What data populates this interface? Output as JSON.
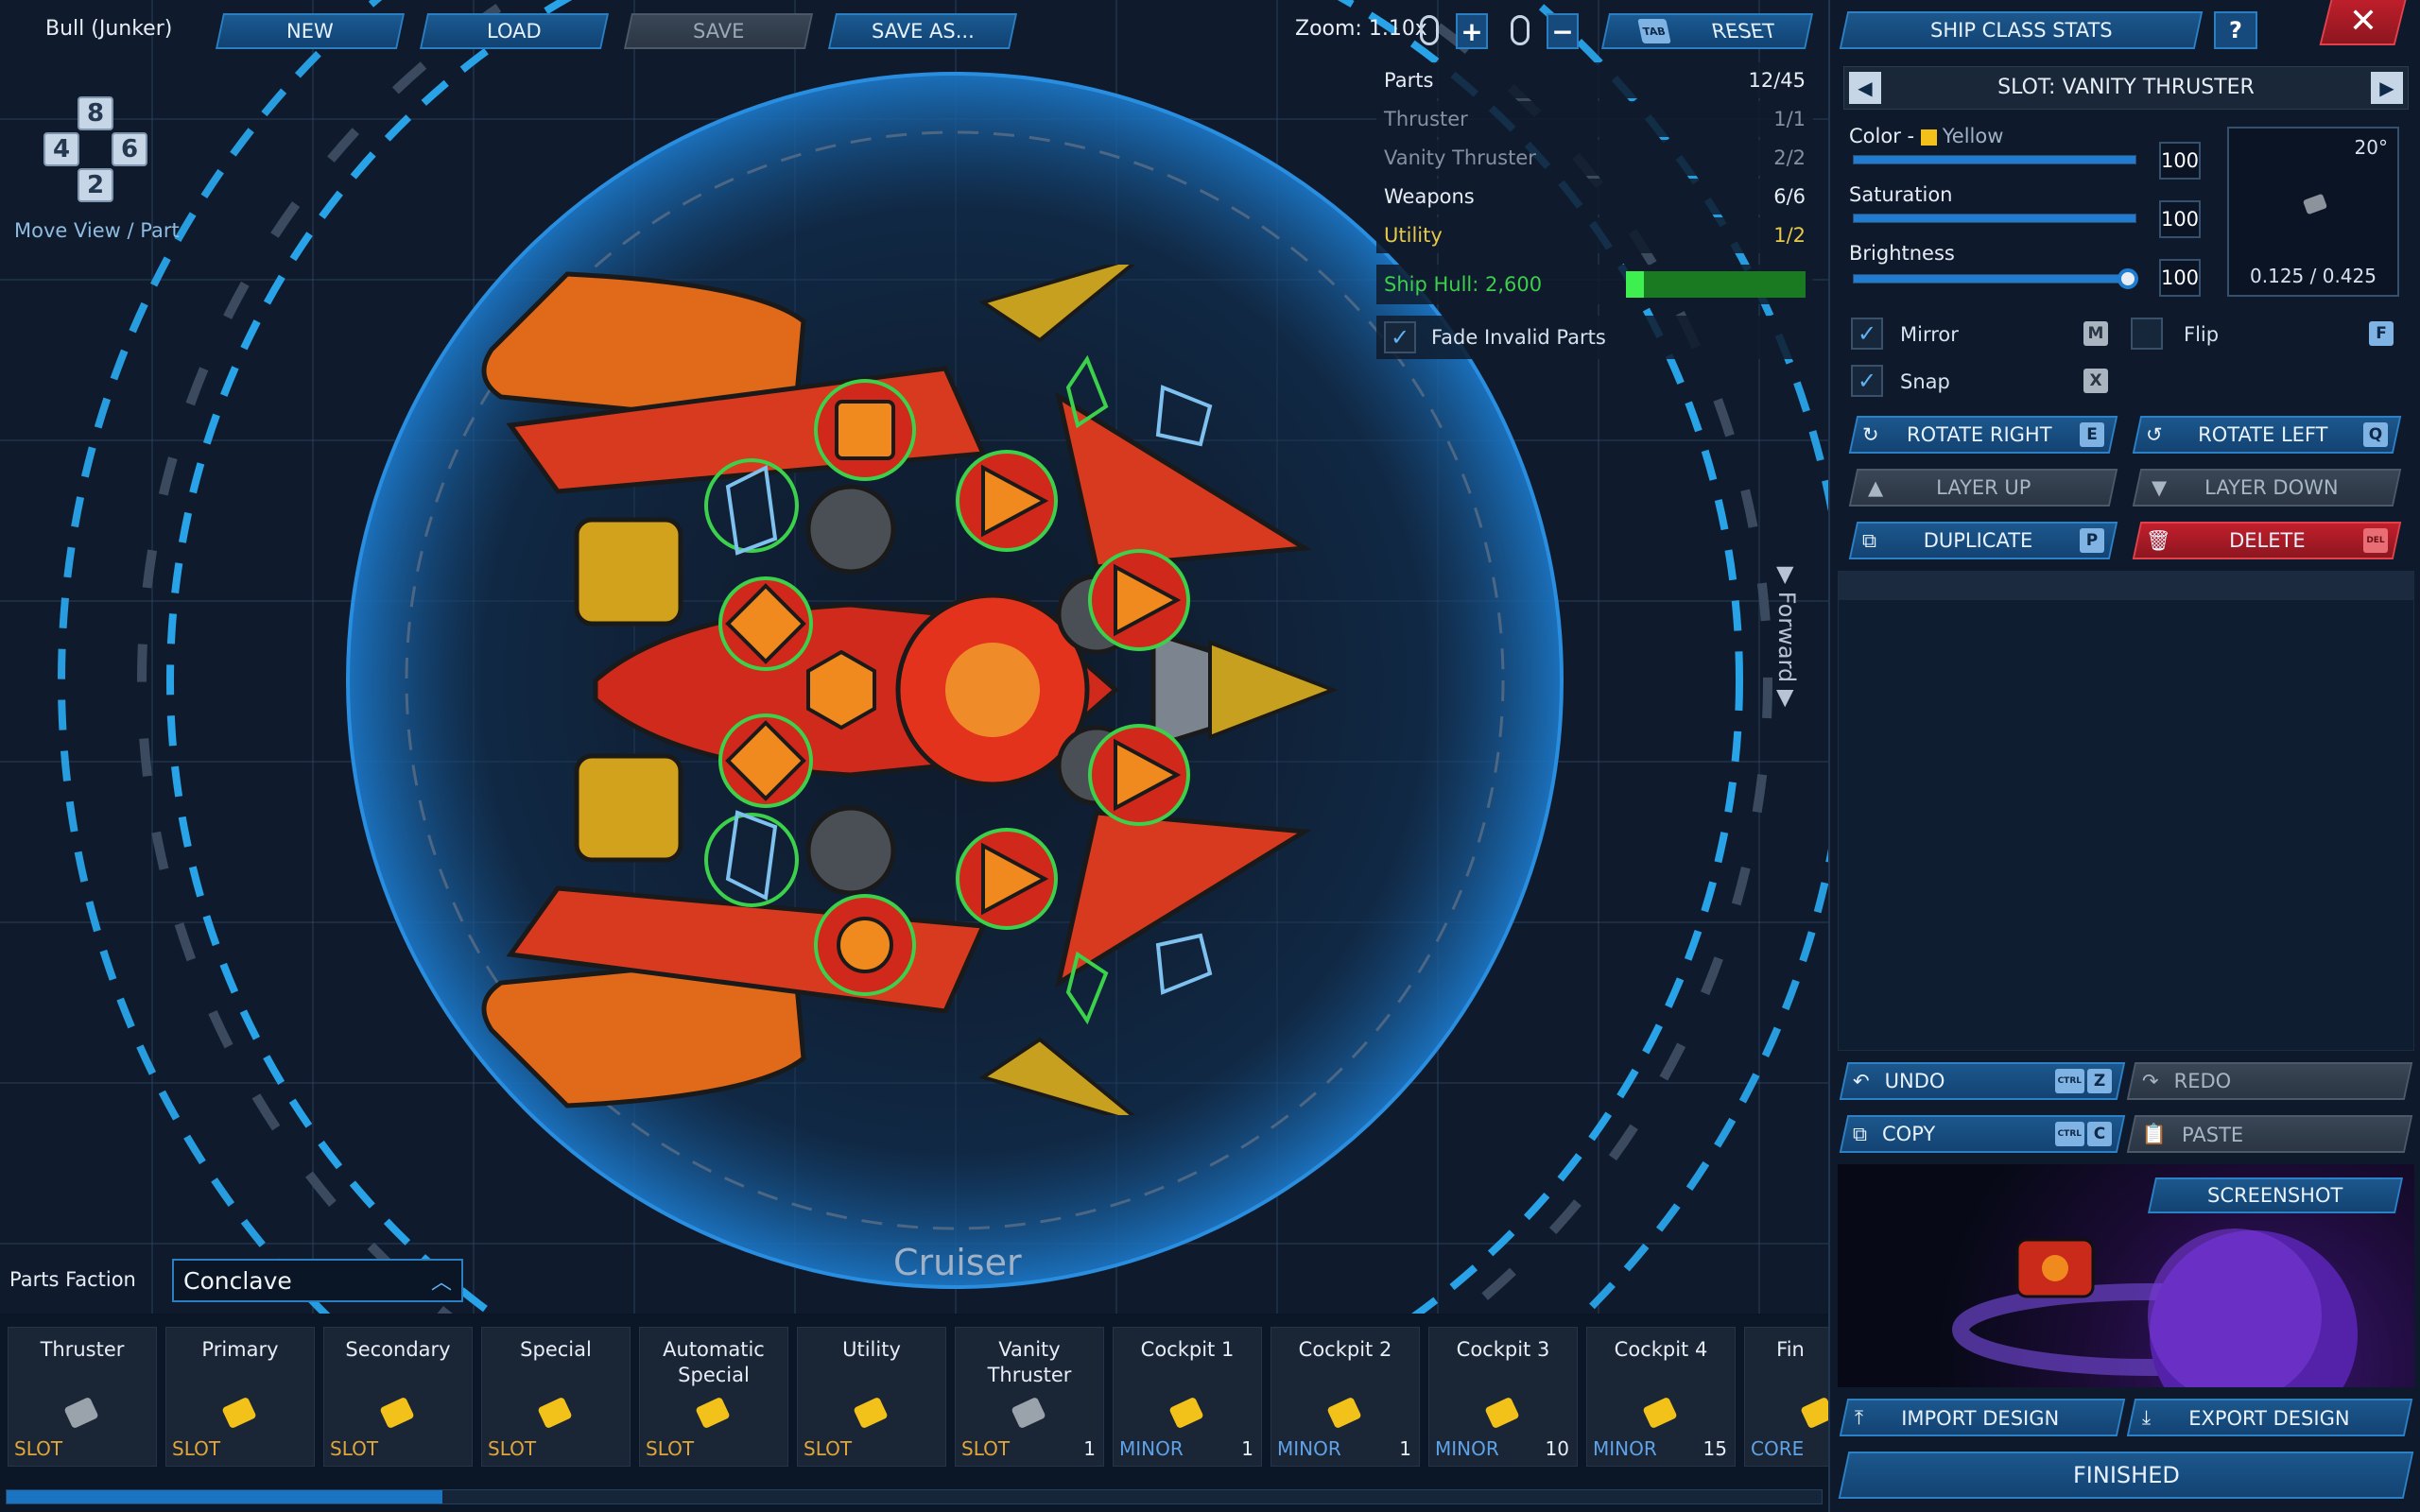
{
  "design_name": "Bull (Junker)",
  "toolbar": {
    "new": "NEW",
    "load": "LOAD",
    "save": "SAVE",
    "save_as": "SAVE AS...",
    "zoom": "Zoom: 1.10x",
    "zoom_in": "+",
    "zoom_out": "−",
    "tab_key": "TAB",
    "reset": "RESET"
  },
  "move_view": {
    "keys": [
      "8",
      "4",
      "6",
      "2"
    ],
    "label": "Move View / Part"
  },
  "stats": {
    "rows": [
      {
        "label": "Parts",
        "value": "12/45",
        "color": "#e6edf5"
      },
      {
        "label": "Thruster",
        "value": "1/1",
        "color": "#8391a2"
      },
      {
        "label": "Vanity Thruster",
        "value": "2/2",
        "color": "#8391a2"
      },
      {
        "label": "Weapons",
        "value": "6/6",
        "color": "#e6edf5"
      },
      {
        "label": "Utility",
        "value": "1/2",
        "color": "#e6c84a"
      }
    ],
    "hull_label": "Ship Hull: 2,600",
    "hull_fraction": 0.1,
    "fade_label": "Fade Invalid Parts",
    "fade_checked": true
  },
  "forward_label": "Forward",
  "class_label": "Cruiser",
  "faction": {
    "label": "Parts Faction",
    "value": "Conclave"
  },
  "panel": {
    "class_stats": "SHIP CLASS STATS",
    "help": "?",
    "close": "✕",
    "slot_title": "SLOT: VANITY THRUSTER",
    "color_label": "Color - ",
    "color_name": "Yellow",
    "color_swatch": "#f2c21a",
    "color_value": "100",
    "saturation_label": "Saturation",
    "saturation_value": "100",
    "brightness_label": "Brightness",
    "brightness_value": "100",
    "brightness_level": 0.97,
    "rotation": "20°",
    "coords": "0.125 / 0.425",
    "mirror": "Mirror",
    "mirror_key": "M",
    "flip": "Flip",
    "flip_key": "F",
    "snap": "Snap",
    "snap_key": "X",
    "rotate_right": "ROTATE RIGHT",
    "rotate_right_key": "E",
    "rotate_left": "ROTATE LEFT",
    "rotate_left_key": "Q",
    "layer_up": "LAYER UP",
    "layer_down": "LAYER DOWN",
    "duplicate": "DUPLICATE",
    "duplicate_key": "P",
    "delete": "DELETE",
    "delete_key": "DEL",
    "undo": "UNDO",
    "redo": "REDO",
    "copy": "COPY",
    "paste": "PASTE",
    "ctrl_key": "CTRL",
    "undo_key": "Z",
    "copy_key": "C",
    "screenshot": "SCREENSHOT",
    "import": "IMPORT DESIGN",
    "export": "EXPORT DESIGN",
    "finished": "FINISHED"
  },
  "part_slots": [
    {
      "title": "Thruster",
      "badge": "SLOT",
      "num": "",
      "kind": "slot"
    },
    {
      "title": "Primary",
      "badge": "SLOT",
      "num": "",
      "kind": "slot"
    },
    {
      "title": "Secondary",
      "badge": "SLOT",
      "num": "",
      "kind": "slot"
    },
    {
      "title": "Special",
      "badge": "SLOT",
      "num": "",
      "kind": "slot"
    },
    {
      "title": "Automatic Special",
      "badge": "SLOT",
      "num": "",
      "kind": "slot"
    },
    {
      "title": "Utility",
      "badge": "SLOT",
      "num": "",
      "kind": "slot"
    },
    {
      "title": "Vanity Thruster",
      "badge": "SLOT",
      "num": "1",
      "kind": "slot"
    },
    {
      "title": "Cockpit 1",
      "badge": "MINOR",
      "num": "1",
      "kind": "minor"
    },
    {
      "title": "Cockpit 2",
      "badge": "MINOR",
      "num": "1",
      "kind": "minor"
    },
    {
      "title": "Cockpit 3",
      "badge": "MINOR",
      "num": "10",
      "kind": "minor"
    },
    {
      "title": "Cockpit 4",
      "badge": "MINOR",
      "num": "15",
      "kind": "minor"
    },
    {
      "title": "Fin",
      "badge": "CORE",
      "num": "",
      "kind": "minor"
    }
  ],
  "scroll_fraction": 0.24
}
